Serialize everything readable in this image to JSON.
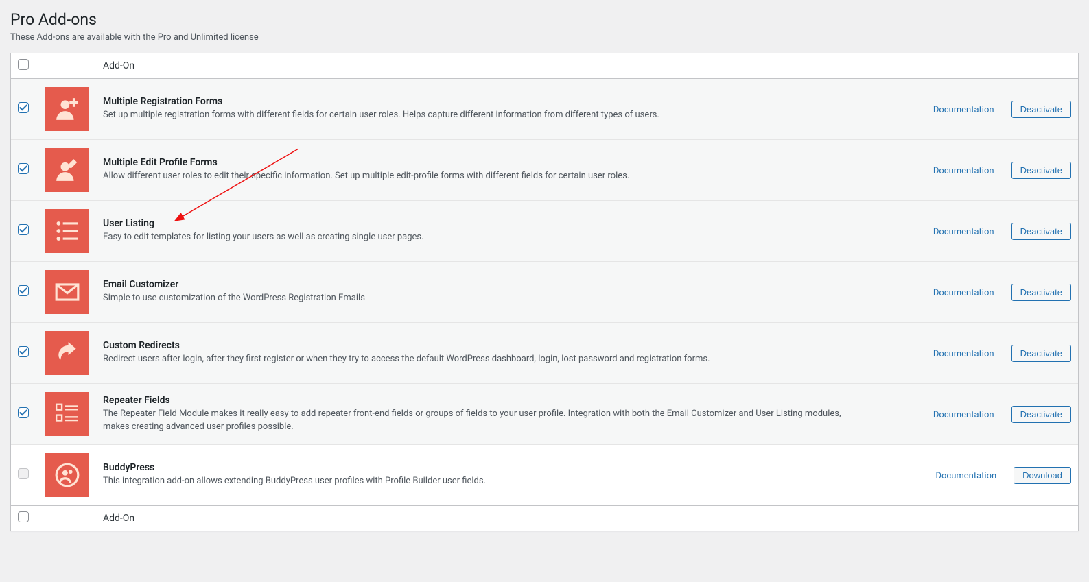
{
  "page": {
    "title": "Pro Add-ons",
    "description": "These Add-ons are available with the Pro and Unlimited license"
  },
  "table": {
    "header_checkbox_col": "",
    "header_addon_col": "Add-On",
    "footer_addon_col": "Add-On"
  },
  "labels": {
    "documentation": "Documentation",
    "deactivate": "Deactivate",
    "download": "Download"
  },
  "addons": [
    {
      "id": "multiple-registration-forms",
      "checked": true,
      "icon": "user-plus",
      "title": "Multiple Registration Forms",
      "description": "Set up multiple registration forms with different fields for certain user roles. Helps capture different information from different types of users.",
      "doc_link_label": "Documentation",
      "action_label": "Deactivate",
      "active": true
    },
    {
      "id": "multiple-edit-profile-forms",
      "checked": true,
      "icon": "user-edit",
      "title": "Multiple Edit Profile Forms",
      "description": "Allow different user roles to edit their specific information. Set up multiple edit-profile forms with different fields for certain user roles.",
      "doc_link_label": "Documentation",
      "action_label": "Deactivate",
      "active": true
    },
    {
      "id": "user-listing",
      "checked": true,
      "icon": "list-users",
      "title": "User Listing",
      "description": "Easy to edit templates for listing your users as well as creating single user pages.",
      "doc_link_label": "Documentation",
      "action_label": "Deactivate",
      "active": true
    },
    {
      "id": "email-customizer",
      "checked": true,
      "icon": "envelope",
      "title": "Email Customizer",
      "description": "Simple to use customization of the WordPress Registration Emails",
      "doc_link_label": "Documentation",
      "action_label": "Deactivate",
      "active": true
    },
    {
      "id": "custom-redirects",
      "checked": true,
      "icon": "redirect",
      "title": "Custom Redirects",
      "description": "Redirect users after login, after they first register or when they try to access the default WordPress dashboard, login, lost password and registration forms.",
      "doc_link_label": "Documentation",
      "action_label": "Deactivate",
      "active": true
    },
    {
      "id": "repeater-fields",
      "checked": true,
      "icon": "repeater",
      "title": "Repeater Fields",
      "description": "The Repeater Field Module makes it really easy to add repeater front-end fields or groups of fields to your user profile. Integration with both the Email Customizer and User Listing modules, makes creating advanced user profiles possible.",
      "doc_link_label": "Documentation",
      "action_label": "Deactivate",
      "active": true
    },
    {
      "id": "buddypress",
      "checked": false,
      "disabled": true,
      "icon": "buddypress",
      "title": "BuddyPress",
      "description": "This integration add-on allows extending BuddyPress user profiles with Profile Builder user fields.",
      "doc_link_label": "Documentation",
      "action_label": "Download",
      "active": false
    }
  ]
}
